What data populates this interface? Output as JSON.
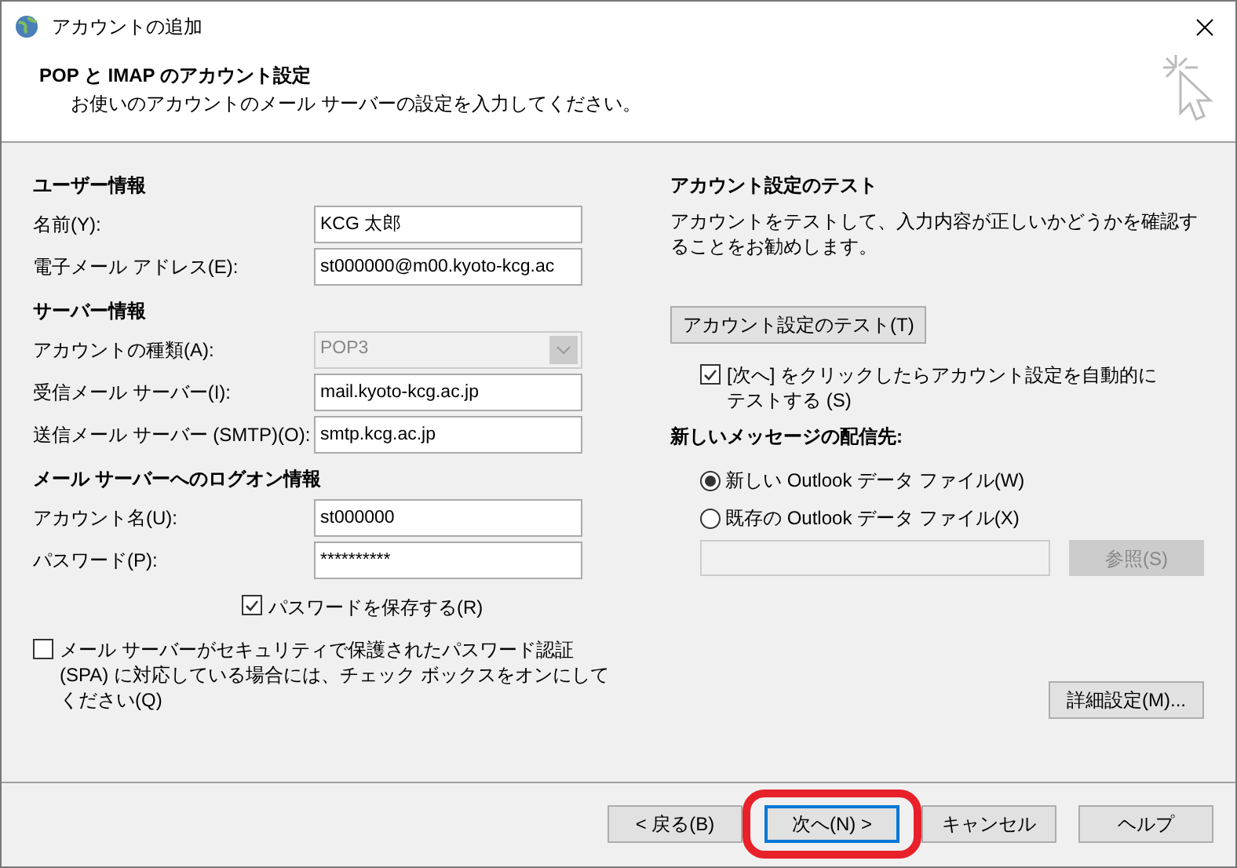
{
  "window": {
    "title": "アカウントの追加"
  },
  "header": {
    "title": "POP と IMAP のアカウント設定",
    "subtitle": "お使いのアカウントのメール サーバーの設定を入力してください。"
  },
  "left_sections": [
    {
      "heading": "ユーザー情報",
      "fields": [
        {
          "kind": "text",
          "label": "名前(Y):",
          "value": "KCG 太郎"
        },
        {
          "kind": "text",
          "label": "電子メール アドレス(E):",
          "value": "st000000@m00.kyoto-kcg.ac"
        }
      ]
    },
    {
      "heading": "サーバー情報",
      "fields": [
        {
          "kind": "select",
          "label": "アカウントの種類(A):",
          "value": "POP3",
          "disabled": true
        },
        {
          "kind": "text",
          "label": "受信メール サーバー(I):",
          "value": "mail.kyoto-kcg.ac.jp"
        },
        {
          "kind": "text",
          "label": "送信メール サーバー (SMTP)(O):",
          "value": "smtp.kcg.ac.jp"
        }
      ]
    },
    {
      "heading": "メール サーバーへのログオン情報",
      "fields": [
        {
          "kind": "text",
          "label": "アカウント名(U):",
          "value": "st000000"
        },
        {
          "kind": "password",
          "label": "パスワード(P):",
          "value": "**********"
        }
      ]
    }
  ],
  "save_password": {
    "label": "パスワードを保存する(R)",
    "checked": true
  },
  "spa": {
    "label": "メール サーバーがセキュリティで保護されたパスワード認証 (SPA) に対応している場合には、チェック ボックスをオンにしてください(Q)",
    "checked": false
  },
  "test": {
    "heading": "アカウント設定のテスト",
    "description": "アカウントをテストして、入力内容が正しいかどうかを確認することをお勧めします。",
    "button": "アカウント設定のテスト(T)",
    "auto_test": {
      "label": "[次へ] をクリックしたらアカウント設定を自動的にテストする (S)",
      "checked": true
    }
  },
  "delivery": {
    "heading": "新しいメッセージの配信先:",
    "options": [
      {
        "label": "新しい Outlook データ ファイル(W)",
        "selected": true
      },
      {
        "label": "既存の Outlook データ ファイル(X)",
        "selected": false
      }
    ],
    "browse_button": {
      "label": "参照(S)",
      "disabled": true
    }
  },
  "more_settings": "詳細設定(M)...",
  "buttons": [
    {
      "label": "< 戻る(B)",
      "focused": false,
      "highlighted": false
    },
    {
      "label": "次へ(N) >",
      "focused": true,
      "highlighted": true
    },
    {
      "label": "キャンセル",
      "focused": false,
      "highlighted": false
    },
    {
      "label": "ヘルプ",
      "focused": false,
      "highlighted": false
    }
  ]
}
